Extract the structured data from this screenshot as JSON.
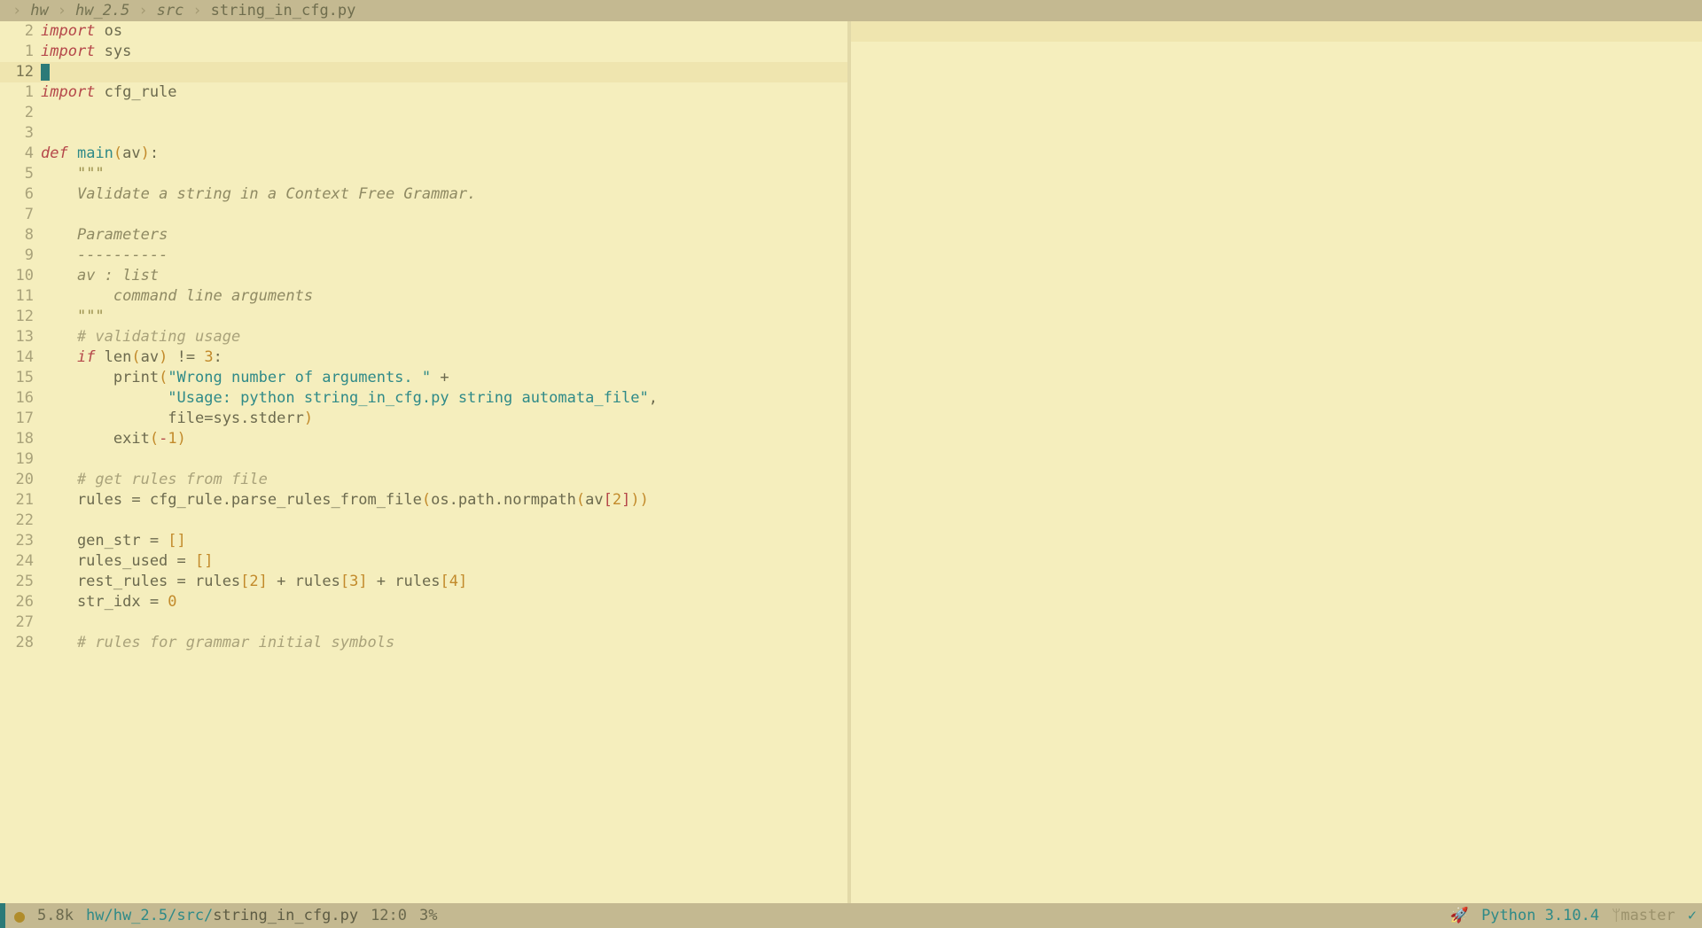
{
  "breadcrumb": {
    "parts": [
      "hw",
      "hw_2.5",
      "src"
    ],
    "file": "string_in_cfg.py",
    "sep": "›"
  },
  "status": {
    "size": "5.8k",
    "path_dir": "hw/hw_2.5/src/",
    "path_file": "string_in_cfg.py",
    "cursor": "12:0",
    "percent": "3%",
    "rocket": "🚀",
    "language": "Python 3.10.4",
    "branch_icon": "ᛘ",
    "branch": "master",
    "check": "✓"
  },
  "gutter": [
    "2",
    "1",
    "12",
    "1",
    "2",
    "3",
    "4",
    "5",
    "6",
    "7",
    "8",
    "9",
    "10",
    "11",
    "12",
    "13",
    "14",
    "15",
    "16",
    "17",
    "18",
    "19",
    "20",
    "21",
    "22",
    "23",
    "24",
    "25",
    "26",
    "27",
    "28"
  ],
  "code": {
    "l0": {
      "a": "import",
      "b": " os"
    },
    "l1": {
      "a": "import",
      "b": " sys"
    },
    "l2": {
      "cursor": true
    },
    "l3": {
      "a": "import",
      "b": " cfg_rule"
    },
    "l4": "",
    "l5": "",
    "l6": {
      "a": "def",
      "b": " ",
      "c": "main",
      "d": "(",
      "e": "av",
      "f": ")",
      "g": ":"
    },
    "l7": {
      "a": "    ",
      "q": "\"\"\""
    },
    "l8": {
      "a": "    ",
      "t": "Validate a string in a Context Free Grammar."
    },
    "l9": "",
    "l10": {
      "a": "    ",
      "t": "Parameters"
    },
    "l11": {
      "a": "    ",
      "t": "----------"
    },
    "l12": {
      "a": "    ",
      "t": "av : list"
    },
    "l13": {
      "a": "        ",
      "t": "command line arguments"
    },
    "l14": {
      "a": "    ",
      "q": "\"\"\""
    },
    "l15": {
      "a": "    ",
      "t": "# validating usage"
    },
    "l16": {
      "a": "    ",
      "k": "if",
      "b": " len",
      "lp": "(",
      "c": "av",
      "rp": ")",
      "d": " != ",
      "n": "3",
      "e": ":"
    },
    "l17": {
      "a": "        print",
      "lp": "(",
      "s": "\"Wrong number of arguments. \"",
      "b": " +"
    },
    "l18": {
      "a": "              ",
      "s": "\"Usage: python string_in_cfg.py string automata_file\"",
      "b": ","
    },
    "l19": {
      "a": "              file=sys.stderr",
      "rp": ")"
    },
    "l20": {
      "a": "        exit",
      "lp": "(",
      "neg": "-",
      "n": "1",
      "rp": ")"
    },
    "l21": "",
    "l22": {
      "a": "    ",
      "t": "# get rules from file"
    },
    "l23": {
      "a": "    rules = cfg_rule.parse_rules_from_file",
      "lp": "(",
      "b": "os.path.normpath",
      "lp2": "(",
      "c": "av",
      "lb": "[",
      "n": "2",
      "rb": "]",
      "rp2": ")",
      "rp": ")"
    },
    "l24": "",
    "l25": {
      "a": "    gen_str = ",
      "lb": "[",
      "rb": "]"
    },
    "l26": {
      "a": "    rules_used = ",
      "lb": "[",
      "rb": "]"
    },
    "l27": {
      "a": "    rest_rules = rules",
      "lb": "[",
      "n": "2",
      "rb": "]",
      "b": " + rules",
      "lb2": "[",
      "n2": "3",
      "rb2": "]",
      "c": " + rules",
      "lb3": "[",
      "n3": "4",
      "rb3": "]"
    },
    "l28": {
      "a": "    str_idx = ",
      "n": "0"
    },
    "l29": "",
    "l30": {
      "a": "    ",
      "t": "# rules for grammar initial symbols"
    }
  }
}
